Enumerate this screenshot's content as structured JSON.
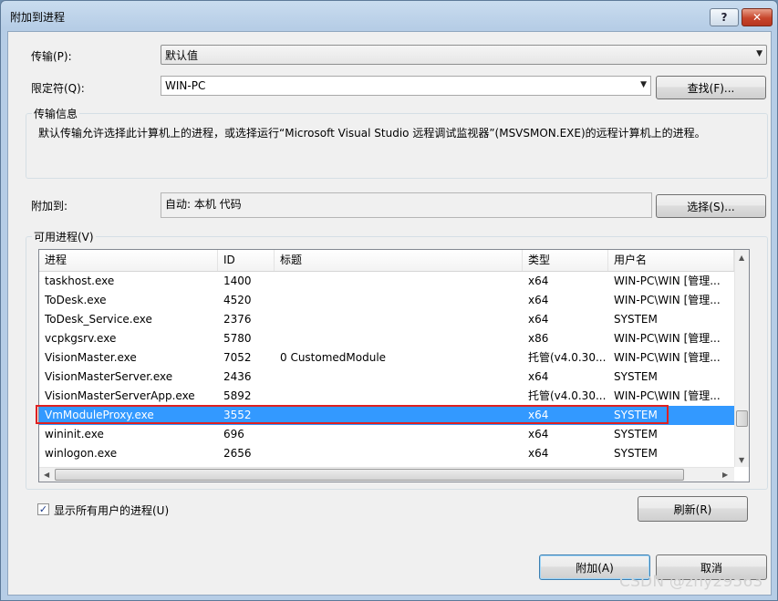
{
  "window": {
    "title": "附加到进程"
  },
  "titlebar": {
    "help": "?",
    "close": "✕"
  },
  "transport": {
    "label": "传输(P):",
    "value": "默认值"
  },
  "qualifier": {
    "label": "限定符(Q):",
    "value": "WIN-PC",
    "find_button": "查找(F)..."
  },
  "transport_info": {
    "group_label": "传输信息",
    "text": "默认传输允许选择此计算机上的进程，或选择运行“Microsoft Visual Studio 远程调试监视器”(MSVSMON.EXE)的远程计算机上的进程。"
  },
  "attach_to": {
    "label": "附加到:",
    "value": "自动: 本机 代码",
    "select_button": "选择(S)..."
  },
  "processes": {
    "group_label": "可用进程(V)",
    "columns": [
      "进程",
      "ID",
      "标题",
      "类型",
      "用户名"
    ],
    "rows": [
      {
        "name": "taskhost.exe",
        "id": "1400",
        "title": "",
        "type": "x64",
        "user": "WIN-PC\\WIN [管理..."
      },
      {
        "name": "ToDesk.exe",
        "id": "4520",
        "title": "",
        "type": "x64",
        "user": "WIN-PC\\WIN [管理..."
      },
      {
        "name": "ToDesk_Service.exe",
        "id": "2376",
        "title": "",
        "type": "x64",
        "user": "SYSTEM"
      },
      {
        "name": "vcpkgsrv.exe",
        "id": "5780",
        "title": "",
        "type": "x86",
        "user": "WIN-PC\\WIN [管理..."
      },
      {
        "name": "VisionMaster.exe",
        "id": "7052",
        "title": "0 CustomedModule",
        "type": "托管(v4.0.30...",
        "user": "WIN-PC\\WIN [管理..."
      },
      {
        "name": "VisionMasterServer.exe",
        "id": "2436",
        "title": "",
        "type": "x64",
        "user": "SYSTEM"
      },
      {
        "name": "VisionMasterServerApp.exe",
        "id": "5892",
        "title": "",
        "type": "托管(v4.0.30...",
        "user": "WIN-PC\\WIN [管理..."
      },
      {
        "name": "VmModuleProxy.exe",
        "id": "3552",
        "title": "",
        "type": "x64",
        "user": "SYSTEM"
      },
      {
        "name": "wininit.exe",
        "id": "696",
        "title": "",
        "type": "x64",
        "user": "SYSTEM"
      },
      {
        "name": "winlogon.exe",
        "id": "2656",
        "title": "",
        "type": "x64",
        "user": "SYSTEM"
      }
    ],
    "selected_row": "VmModuleProxy.exe"
  },
  "show_all_users": {
    "label": "显示所有用户的进程(U)",
    "checked": true
  },
  "buttons": {
    "refresh": "刷新(R)",
    "attach": "附加(A)",
    "cancel": "取消"
  },
  "watermark": "CSDN @zhy29563",
  "colors": {
    "selection": "#3399ff",
    "highlight_border": "#e02020"
  }
}
